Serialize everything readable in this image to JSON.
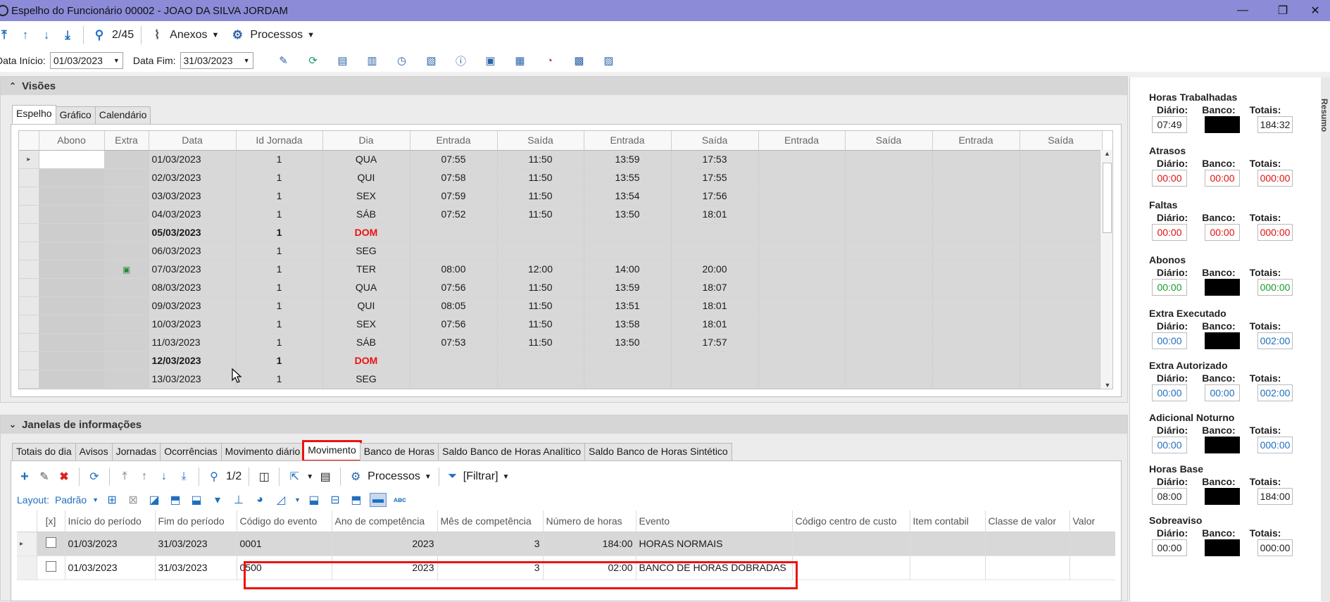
{
  "window": {
    "title": "Espelho do Funcionário 00002 - JOAO DA SILVA JORDAM",
    "minimize": "—",
    "restore": "❐",
    "close": "✕"
  },
  "toolbar": {
    "nav_counter": "2/45",
    "anexos_label": "Anexos",
    "processos_label": "Processos"
  },
  "filters": {
    "inicio_label": "Data Início:",
    "inicio_value": "01/03/2023",
    "fim_label": "Data Fim:",
    "fim_value": "31/03/2023"
  },
  "visoes": {
    "header": "Visões",
    "tabs": [
      "Espelho",
      "Gráfico",
      "Calendário"
    ],
    "columns": [
      "Abono",
      "Extra",
      "Data",
      "Id Jornada",
      "Dia",
      "Entrada",
      "Saída",
      "Entrada",
      "Saída",
      "Entrada",
      "Saída",
      "Entrada",
      "Saída"
    ],
    "rows": [
      {
        "data": "01/03/2023",
        "jornada": "1",
        "dia": "QUA",
        "e1": "07:55",
        "s1": "11:50",
        "e2": "13:59",
        "s2": "17:53"
      },
      {
        "data": "02/03/2023",
        "jornada": "1",
        "dia": "QUI",
        "e1": "07:58",
        "s1": "11:50",
        "e2": "13:55",
        "s2": "17:55"
      },
      {
        "data": "03/03/2023",
        "jornada": "1",
        "dia": "SEX",
        "e1": "07:59",
        "s1": "11:50",
        "e2": "13:54",
        "s2": "17:56"
      },
      {
        "data": "04/03/2023",
        "jornada": "1",
        "dia": "SÁB",
        "e1": "07:52",
        "s1": "11:50",
        "e2": "13:50",
        "s2": "18:01"
      },
      {
        "data": "05/03/2023",
        "jornada": "1",
        "dia": "DOM",
        "e1": "",
        "s1": "",
        "e2": "",
        "s2": ""
      },
      {
        "data": "06/03/2023",
        "jornada": "1",
        "dia": "SEG",
        "e1": "",
        "s1": "",
        "e2": "",
        "s2": ""
      },
      {
        "data": "07/03/2023",
        "jornada": "1",
        "dia": "TER",
        "e1": "08:00",
        "s1": "12:00",
        "e2": "14:00",
        "s2": "20:00"
      },
      {
        "data": "08/03/2023",
        "jornada": "1",
        "dia": "QUA",
        "e1": "07:56",
        "s1": "11:50",
        "e2": "13:59",
        "s2": "18:07"
      },
      {
        "data": "09/03/2023",
        "jornada": "1",
        "dia": "QUI",
        "e1": "08:05",
        "s1": "11:50",
        "e2": "13:51",
        "s2": "18:01"
      },
      {
        "data": "10/03/2023",
        "jornada": "1",
        "dia": "SEX",
        "e1": "07:56",
        "s1": "11:50",
        "e2": "13:58",
        "s2": "18:01"
      },
      {
        "data": "11/03/2023",
        "jornada": "1",
        "dia": "SÁB",
        "e1": "07:53",
        "s1": "11:50",
        "e2": "13:50",
        "s2": "17:57"
      },
      {
        "data": "12/03/2023",
        "jornada": "1",
        "dia": "DOM",
        "e1": "",
        "s1": "",
        "e2": "",
        "s2": ""
      },
      {
        "data": "13/03/2023",
        "jornada": "1",
        "dia": "SEG",
        "e1": "",
        "s1": "",
        "e2": "",
        "s2": ""
      }
    ]
  },
  "janelas": {
    "header": "Janelas de informações",
    "tabs": [
      "Totais do dia",
      "Avisos",
      "Jornadas",
      "Ocorrências",
      "Movimento diário",
      "Movimento",
      "Banco de Horas",
      "Saldo Banco de Horas Analítico",
      "Saldo Banco de Horas Sintético"
    ],
    "toolbar": {
      "counter": "1/2",
      "processos": "Processos",
      "filtrar": "[Filtrar]",
      "layout_label": "Layout:",
      "layout_value": "Padrão"
    },
    "columns": [
      "[x]",
      "Início do período",
      "Fim do período",
      "Código do evento",
      "Ano de competência",
      "Mês de competência",
      "Número de horas",
      "Evento",
      "Código centro de custo",
      "Item contabil",
      "Classe de valor",
      "Valor"
    ],
    "rows": [
      {
        "inicio": "01/03/2023",
        "fim": "31/03/2023",
        "codigo": "0001",
        "ano": "2023",
        "mes": "3",
        "horas": "184:00",
        "evento": "HORAS NORMAIS"
      },
      {
        "inicio": "01/03/2023",
        "fim": "31/03/2023",
        "codigo": "0500",
        "ano": "2023",
        "mes": "3",
        "horas": "02:00",
        "evento": "BANCO DE HORAS DOBRADAS"
      }
    ]
  },
  "resumo": {
    "side_label": "Resumo",
    "col_labels": [
      "Diário:",
      "Banco:",
      "Totais:"
    ],
    "groups": [
      {
        "title": "Horas Trabalhadas",
        "diario": "07:49",
        "banco": "",
        "totais": "184:32",
        "color": "#222222",
        "banco_black": true
      },
      {
        "title": "Atrasos",
        "diario": "00:00",
        "banco": "00:00",
        "totais": "000:00",
        "color": "#e01010",
        "banco_black": false
      },
      {
        "title": "Faltas",
        "diario": "00:00",
        "banco": "00:00",
        "totais": "000:00",
        "color": "#e01010",
        "banco_black": false
      },
      {
        "title": "Abonos",
        "diario": "00:00",
        "banco": "",
        "totais": "000:00",
        "color": "#1a9a2a",
        "banco_black": true
      },
      {
        "title": "Extra Executado",
        "diario": "00:00",
        "banco": "",
        "totais": "002:00",
        "color": "#1f6fbf",
        "banco_black": true
      },
      {
        "title": "Extra Autorizado",
        "diario": "00:00",
        "banco": "00:00",
        "totais": "002:00",
        "color": "#1f6fbf",
        "banco_black": false
      },
      {
        "title": "Adicional Noturno",
        "diario": "00:00",
        "banco": "",
        "totais": "000:00",
        "color": "#1f6fbf",
        "banco_black": true
      },
      {
        "title": "Horas Base",
        "diario": "08:00",
        "banco": "",
        "totais": "184:00",
        "color": "#222222",
        "banco_black": true
      },
      {
        "title": "Sobreaviso",
        "diario": "00:00",
        "banco": "",
        "totais": "000:00",
        "color": "#222222",
        "banco_black": true
      }
    ]
  }
}
